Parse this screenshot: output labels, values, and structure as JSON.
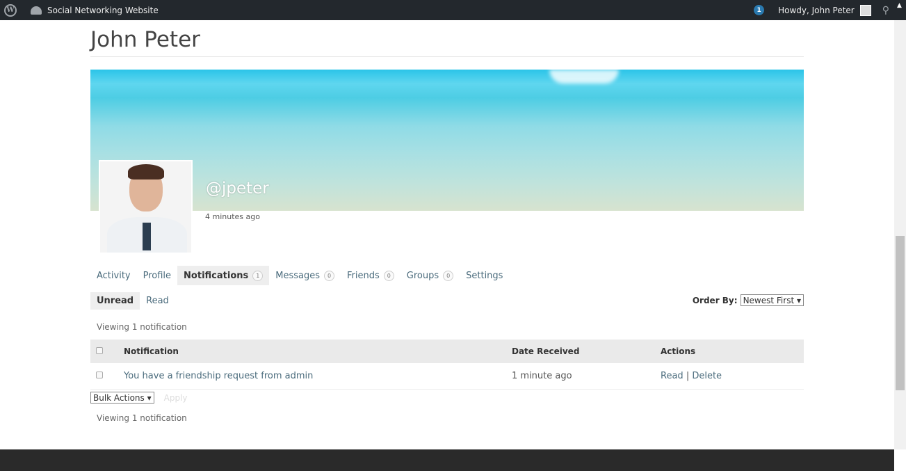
{
  "adminbar": {
    "site_name": "Social Networking Website",
    "notif_count": "1",
    "greeting": "Howdy, John Peter"
  },
  "profile": {
    "name": "John Peter",
    "handle": "@jpeter",
    "last_active": "4 minutes ago"
  },
  "tabs": [
    {
      "label": "Activity"
    },
    {
      "label": "Profile"
    },
    {
      "label": "Notifications",
      "count": "1",
      "active": true
    },
    {
      "label": "Messages",
      "count": "0"
    },
    {
      "label": "Friends",
      "count": "0"
    },
    {
      "label": "Groups",
      "count": "0"
    },
    {
      "label": "Settings"
    }
  ],
  "subtabs": [
    {
      "label": "Unread",
      "active": true
    },
    {
      "label": "Read"
    }
  ],
  "order": {
    "label": "Order By:",
    "value": "Newest First"
  },
  "viewing": "Viewing 1 notification",
  "table": {
    "headers": [
      "Notification",
      "Date Received",
      "Actions"
    ],
    "rows": [
      {
        "text": "You have a friendship request from admin",
        "date": "1 minute ago",
        "read": "Read",
        "sep": "|",
        "delete": "Delete"
      }
    ]
  },
  "bulk": {
    "value": "Bulk Actions",
    "apply": "Apply"
  },
  "colors": {
    "adminbar": "#23282d",
    "link": "#4a6b7c",
    "badge": "#2a7ab0"
  }
}
